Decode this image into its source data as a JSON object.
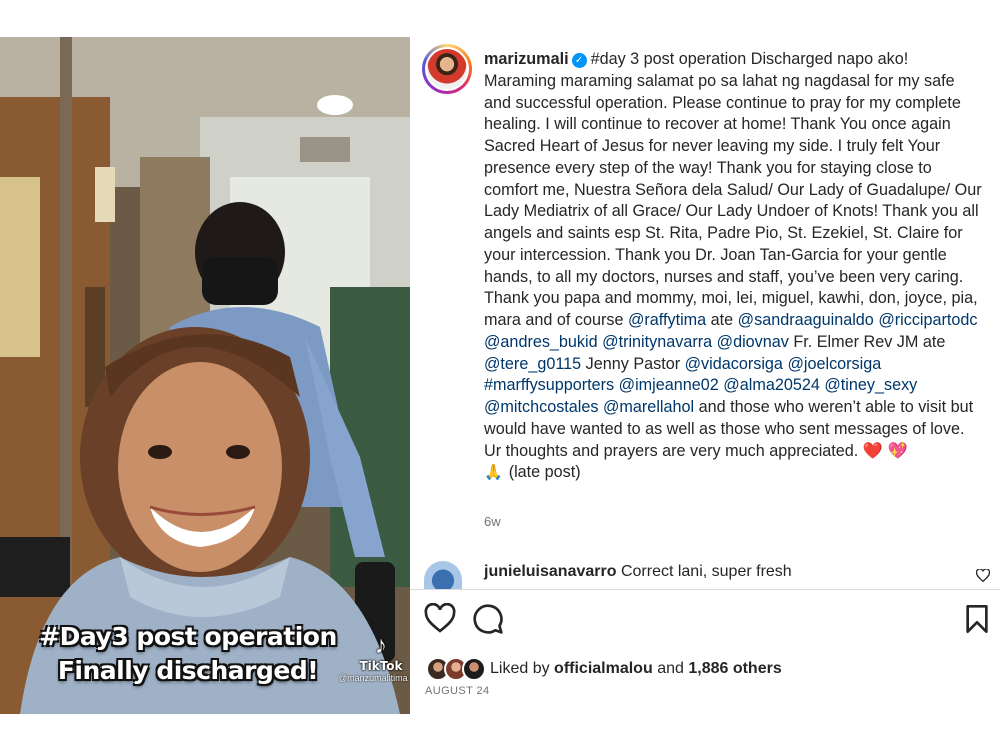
{
  "post": {
    "username": "marizumali",
    "caption_segments": [
      {
        "type": "text",
        "text": "#day 3 post operation Discharged napo ako! Maraming maraming salamat po sa lahat ng nagdasal for my safe and successful operation. Please continue to pray for my complete healing. I will continue to recover at home! Thank You once again Sacred Heart of Jesus for never leaving my side. I truly felt Your presence every step of the way! Thank you for staying close to comfort me, Nuestra Señora dela Salud/ Our Lady of Guadalupe/ Our Lady Mediatrix of all Grace/ Our Lady Undoer of Knots! Thank you all angels and saints esp St. Rita, Padre Pio, St. Ezekiel, St. Claire for your intercession. Thank you Dr. Joan Tan-Garcia for your gentle hands, to all my doctors, nurses and staff, you’ve been very caring. Thank you papa and mommy, moi, lei, miguel, kawhi, don, joyce, pia, mara and of course "
      },
      {
        "type": "mention",
        "text": "@raffytima"
      },
      {
        "type": "text",
        "text": " ate "
      },
      {
        "type": "mention",
        "text": "@sandraaguinaldo"
      },
      {
        "type": "text",
        "text": " "
      },
      {
        "type": "mention",
        "text": "@riccipartodc"
      },
      {
        "type": "text",
        "text": " "
      },
      {
        "type": "mention",
        "text": "@andres_bukid"
      },
      {
        "type": "text",
        "text": " "
      },
      {
        "type": "mention",
        "text": "@trinitynavarra"
      },
      {
        "type": "text",
        "text": " "
      },
      {
        "type": "mention",
        "text": "@diovnav"
      },
      {
        "type": "text",
        "text": " Fr. Elmer Rev JM ate "
      },
      {
        "type": "mention",
        "text": "@tere_g0115"
      },
      {
        "type": "text",
        "text": " Jenny Pastor "
      },
      {
        "type": "mention",
        "text": "@vidacorsiga"
      },
      {
        "type": "text",
        "text": " "
      },
      {
        "type": "mention",
        "text": "@joelcorsiga"
      },
      {
        "type": "text",
        "text": " "
      },
      {
        "type": "mention",
        "text": "#marffysupporters"
      },
      {
        "type": "text",
        "text": " "
      },
      {
        "type": "mention",
        "text": "@imjeanne02"
      },
      {
        "type": "text",
        "text": " "
      },
      {
        "type": "mention",
        "text": "@alma20524"
      },
      {
        "type": "text",
        "text": " "
      },
      {
        "type": "mention",
        "text": "@tiney_sexy"
      },
      {
        "type": "text",
        "text": " "
      },
      {
        "type": "mention",
        "text": "@mitchcostales"
      },
      {
        "type": "text",
        "text": " "
      },
      {
        "type": "mention",
        "text": "@marellahol"
      },
      {
        "type": "text",
        "text": " and those who weren’t able to visit but would have wanted to as well as those who sent messages of love. Ur thoughts and prayers are very much appreciated. "
      }
    ],
    "emoji_heart": "❤️",
    "emoji_sparkle_heart": "💖",
    "emoji_pray": "🙏",
    "late_post": "(late post)",
    "time_ago": "6w"
  },
  "comment": {
    "username": "junieluisanavarro",
    "text": "Correct lani, super fresh"
  },
  "likes": {
    "prefix": "Liked by",
    "user": "officialmalou",
    "conjunction": "and",
    "count": "1,886 others"
  },
  "date": "AUGUST 24",
  "video": {
    "overlay_line1": "#Day3 post operation",
    "overlay_line2": "Finally discharged!",
    "tiktok_label": "TikTok",
    "tiktok_handle": "@marizumalitima"
  },
  "icons": {
    "verified": "verified-badge-icon",
    "like": "heart-outline-icon",
    "comment": "comment-bubble-icon",
    "save": "bookmark-icon",
    "comment_like": "small-heart-icon",
    "tiktok": "tiktok-logo-icon"
  },
  "colors": {
    "verified": "#0095f6",
    "mention": "#00376b",
    "meta": "#737373",
    "divider": "#dbdbdb"
  }
}
